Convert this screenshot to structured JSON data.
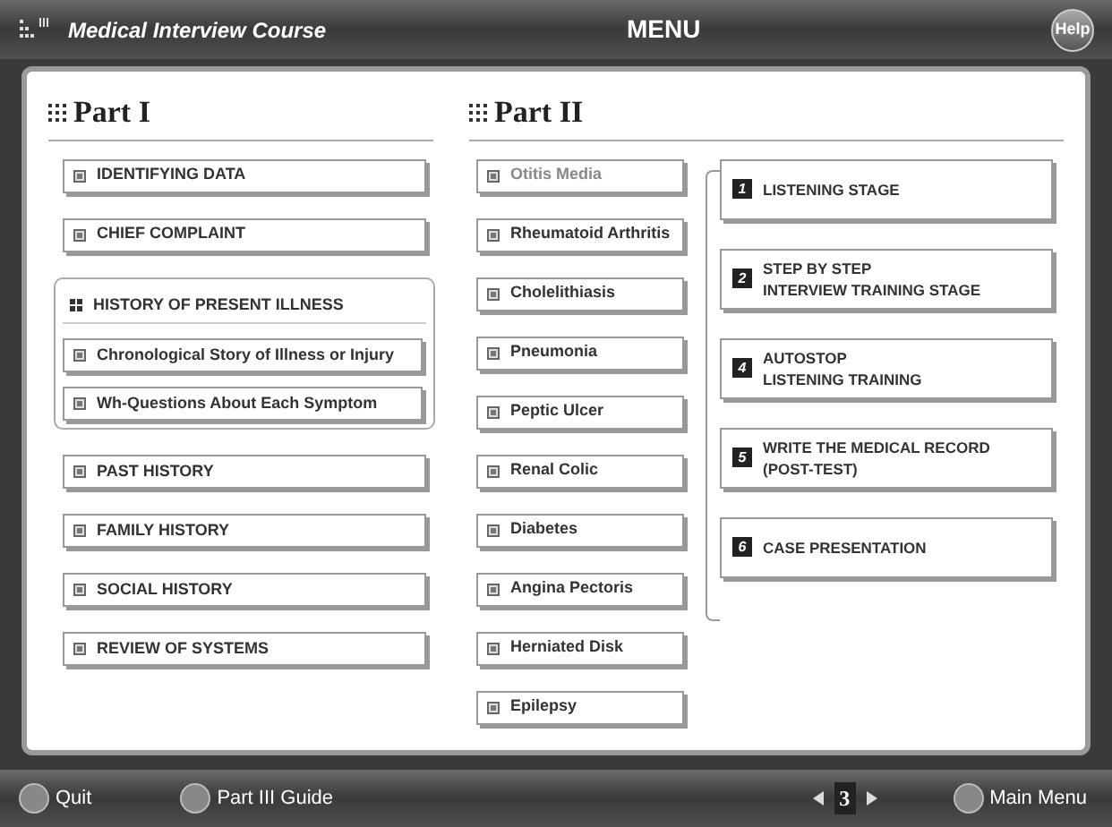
{
  "header": {
    "course": "Medical Interview Course",
    "title": "MENU",
    "help": "Help"
  },
  "part1": {
    "heading": "Part I",
    "items": [
      {
        "kind": "button",
        "label": "IDENTIFYING DATA"
      },
      {
        "kind": "button",
        "label": "CHIEF COMPLAINT"
      },
      {
        "kind": "group",
        "label": "HISTORY OF PRESENT ILLNESS",
        "children": [
          {
            "label": "Chronological Story of Illness or Injury"
          },
          {
            "label": "Wh-Questions About Each Symptom"
          }
        ]
      },
      {
        "kind": "button",
        "label": "PAST HISTORY"
      },
      {
        "kind": "button",
        "label": "FAMILY HISTORY"
      },
      {
        "kind": "button",
        "label": "SOCIAL HISTORY"
      },
      {
        "kind": "button",
        "label": "REVIEW OF SYSTEMS"
      }
    ]
  },
  "part2": {
    "heading": "Part II",
    "cases": [
      {
        "label": "Otitis Media",
        "dimmed": true
      },
      {
        "label": "Rheumatoid Arthritis",
        "dimmed": false
      },
      {
        "label": "Cholelithiasis",
        "dimmed": false
      },
      {
        "label": "Pneumonia",
        "dimmed": false
      },
      {
        "label": "Peptic Ulcer",
        "dimmed": false
      },
      {
        "label": "Renal Colic",
        "dimmed": false
      },
      {
        "label": "Diabetes",
        "dimmed": false
      },
      {
        "label": "Angina Pectoris",
        "dimmed": false
      },
      {
        "label": "Herniated Disk",
        "dimmed": false
      },
      {
        "label": "Epilepsy",
        "dimmed": false
      }
    ],
    "stages": [
      {
        "number": "1",
        "lines": [
          "LISTENING STAGE"
        ]
      },
      {
        "number": "2",
        "lines": [
          "STEP BY STEP",
          "INTERVIEW TRAINING STAGE"
        ]
      },
      {
        "number": "4",
        "lines": [
          "AUTOSTOP",
          "LISTENING TRAINING"
        ]
      },
      {
        "number": "5",
        "lines": [
          "WRITE THE MEDICAL RECORD",
          "(POST-TEST)"
        ]
      },
      {
        "number": "6",
        "lines": [
          "CASE PRESENTATION"
        ]
      }
    ]
  },
  "footer": {
    "quit": "Quit",
    "guide": "Part III Guide",
    "page": "3",
    "main_menu": "Main Menu"
  }
}
